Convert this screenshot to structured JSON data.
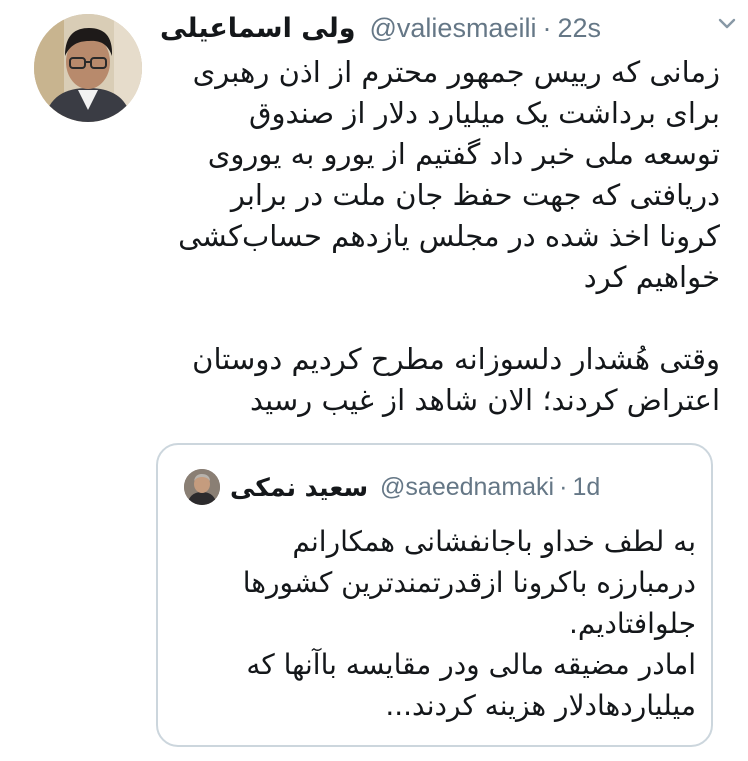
{
  "tweet": {
    "author_name": "ولی اسماعیلی",
    "handle": "@valiesmaeili",
    "separator": "·",
    "time": "22s",
    "body_paragraph_1": [
      "زمانی که رییس جمهور محترم از اذن رهبری",
      "برای برداشت یک میلیارد دلار از صندوق",
      "توسعه ملی خبر داد گفتیم از یورو به یوروی",
      "دریافتی که جهت حفظ جان ملت در برابر",
      "کرونا اخذ شده در مجلس یازدهم حساب‌کشی",
      "خواهیم کرد"
    ],
    "body_paragraph_2": [
      "وقتی هُشدار  دلسوزانه مطرح کردیم دوستان",
      "اعتراض کردند؛ الان شاهد از غیب رسید"
    ]
  },
  "quoted_tweet": {
    "author_name": "سعید نمکی",
    "handle": "@saeednamaki",
    "separator": "·",
    "time": "1d",
    "body": [
      "به لطف خداو باجانفشانی همکارانم",
      "درمبارزه باکرونا ازقدرتمندترین کشورها",
      "جلوافتادیم.",
      "امادر مضیقه مالی ودر مقایسه باآنها که",
      "میلیاردهادلار هزینه کردند..."
    ]
  },
  "icons": {
    "menu": "chevron-down-icon"
  },
  "colors": {
    "text": "#14171a",
    "secondary": "#657786",
    "border": "#ccd6dd"
  }
}
